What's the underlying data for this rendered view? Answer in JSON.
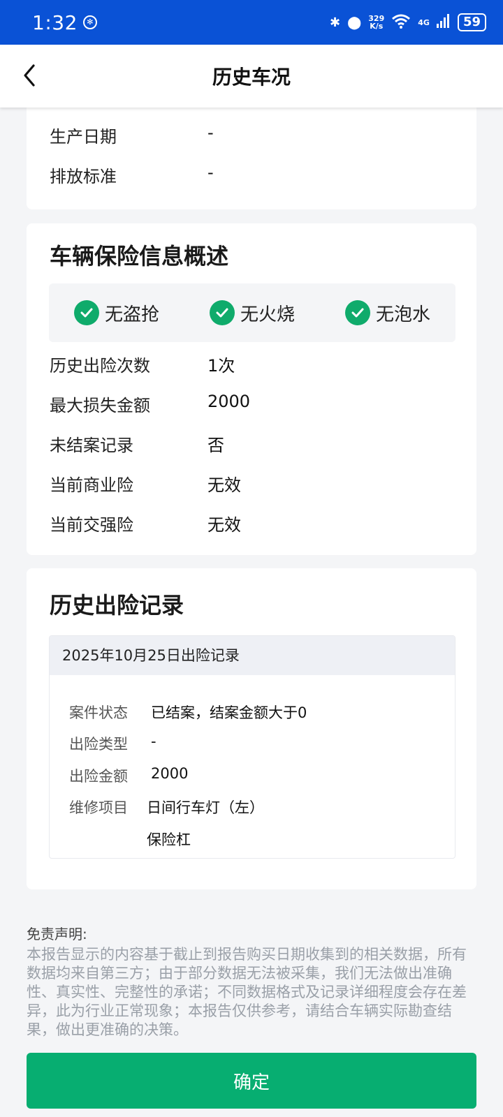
{
  "status_bar": {
    "time": "1:32",
    "speed_value": "329",
    "speed_unit": "K/s",
    "network": "4G",
    "battery": "59"
  },
  "nav": {
    "title": "历史车况"
  },
  "vehicle_info": {
    "rows": [
      {
        "label": "生产日期",
        "value": "-"
      },
      {
        "label": "排放标准",
        "value": "-"
      }
    ]
  },
  "insurance_summary": {
    "title": "车辆保险信息概述",
    "badges": [
      {
        "label": "无盗抢",
        "icon": "check-circle-icon"
      },
      {
        "label": "无火烧",
        "icon": "check-circle-icon"
      },
      {
        "label": "无泡水",
        "icon": "check-circle-icon"
      }
    ],
    "rows": [
      {
        "label": "历史出险次数",
        "value": "1次"
      },
      {
        "label": "最大损失金额",
        "value": "2000"
      },
      {
        "label": "未结案记录",
        "value": "否"
      },
      {
        "label": "当前商业险",
        "value": "无效"
      },
      {
        "label": "当前交强险",
        "value": "无效"
      }
    ]
  },
  "claim_history": {
    "title": "历史出险记录",
    "records": [
      {
        "header": "2025年10月25日出险记录",
        "rows": [
          {
            "label": "案件状态",
            "value": "已结案，结案金额大于0"
          },
          {
            "label": "出险类型",
            "value": "-"
          },
          {
            "label": "出险金额",
            "value": "2000"
          },
          {
            "label": "维修项目",
            "value": "日间行车灯（左）"
          },
          {
            "label": "",
            "value": "保险杠"
          }
        ]
      }
    ]
  },
  "disclaimer": {
    "title": "免责声明:",
    "text": "本报告显示的内容基于截止到报告购买日期收集到的相关数据，所有数据均来自第三方；由于部分数据无法被采集，我们无法做出准确性、真实性、完整性的承诺；不同数据格式及记录详细程度会存在差异，此为行业正常现象；本报告仅供参考，请结合车辆实际勘查结果，做出更准确的决策。"
  },
  "confirm_button": {
    "label": "确定",
    "color": "#07ae71"
  },
  "colors": {
    "status_bar": "#0a52d6",
    "check_green": "#0fab6b"
  }
}
